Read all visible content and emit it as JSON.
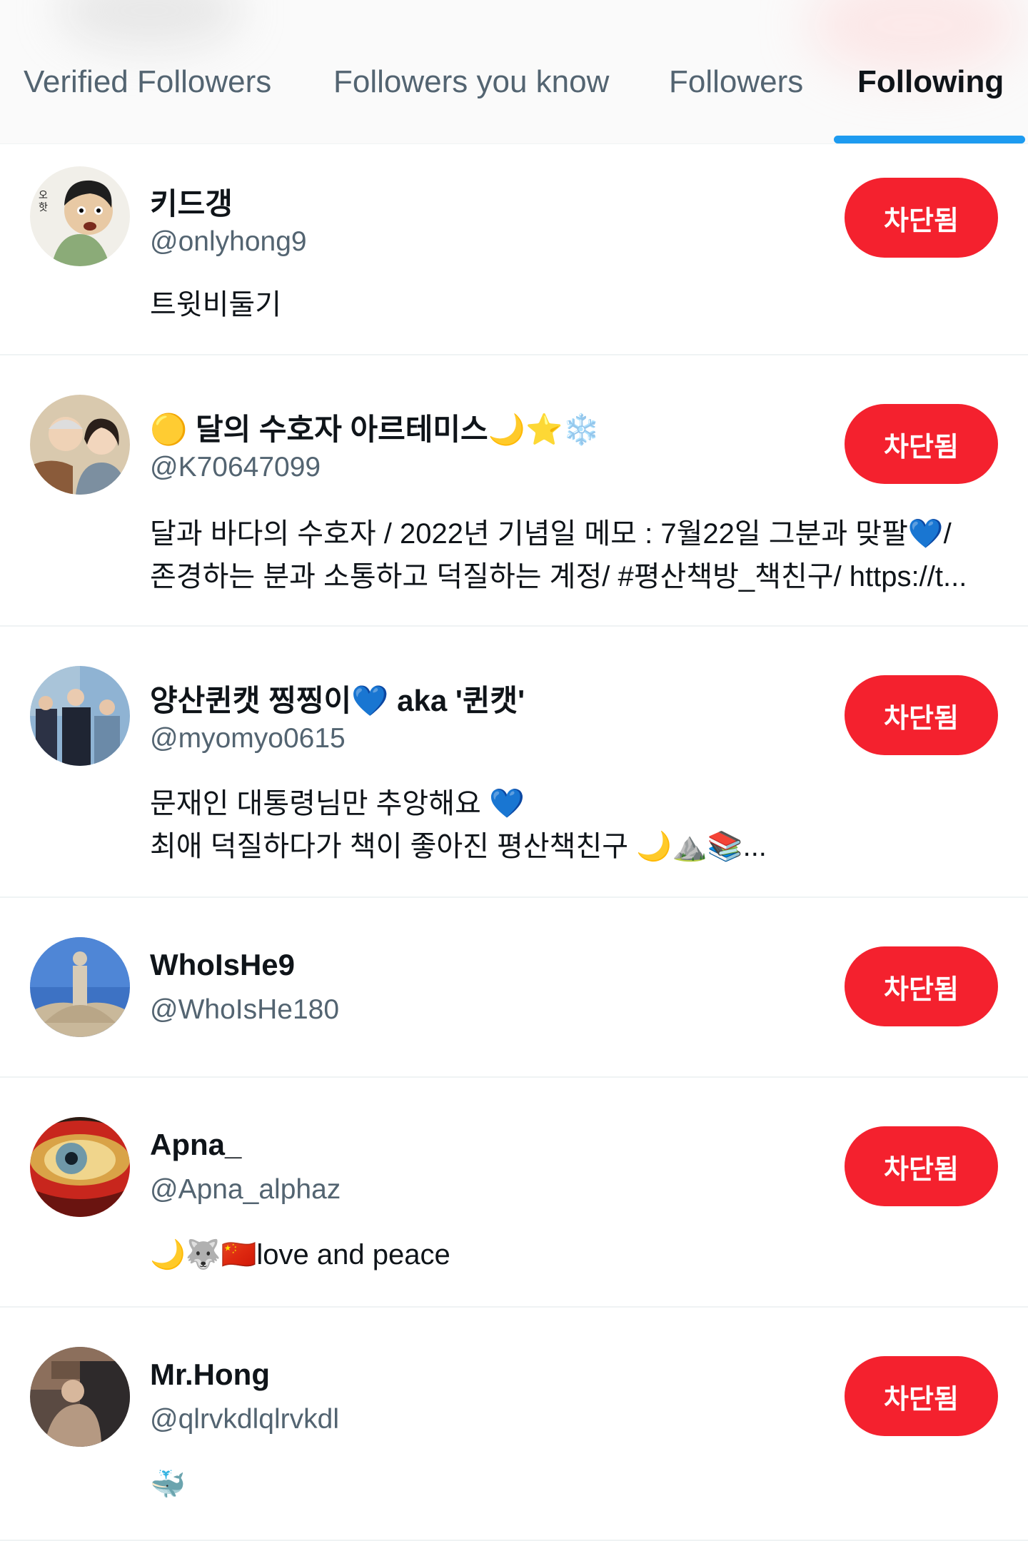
{
  "tabs": [
    {
      "label": "Verified Followers"
    },
    {
      "label": "Followers you know"
    },
    {
      "label": "Followers"
    },
    {
      "label": "Following"
    }
  ],
  "active_tab": "Following",
  "colors": {
    "accent": "#1d9bf0",
    "blocked_button": "#f4212e",
    "secondary_text": "#536471"
  },
  "users": [
    {
      "name": "키드갱",
      "handle": "@onlyhong9",
      "bio": [
        "트윗비둘기"
      ],
      "button": "차단됨"
    },
    {
      "name": "🟡 달의 수호자 아르테미스🌙⭐❄️",
      "handle": "@K70647099",
      "bio": [
        "달과 바다의 수호자 / 2022년 기념일 메모 :  7월22일 그분과 맞팔💙/",
        "존경하는 분과 소통하고 덕질하는 계정/ #평산책방_책친구/ https://t..."
      ],
      "button": "차단됨"
    },
    {
      "name": "양산퀸캣 찡찡이💙 aka '퀸캣'",
      "handle": "@myomyo0615",
      "bio": [
        "문재인 대통령님만 추앙해요 💙",
        "최애 덕질하다가 책이 좋아진 평산책친구 🌙⛰️📚..."
      ],
      "button": "차단됨"
    },
    {
      "name": "WhoIsHe9",
      "handle": "@WhoIsHe180",
      "bio": [],
      "button": "차단됨"
    },
    {
      "name": "Apna_",
      "handle": "@Apna_alphaz",
      "bio": [
        "🌙🐺🇨🇳love and peace"
      ],
      "button": "차단됨"
    },
    {
      "name": "Mr.Hong",
      "handle": "@qlrvkdlqlrvkdl",
      "bio": [
        "🐳"
      ],
      "button": "차단됨"
    }
  ]
}
